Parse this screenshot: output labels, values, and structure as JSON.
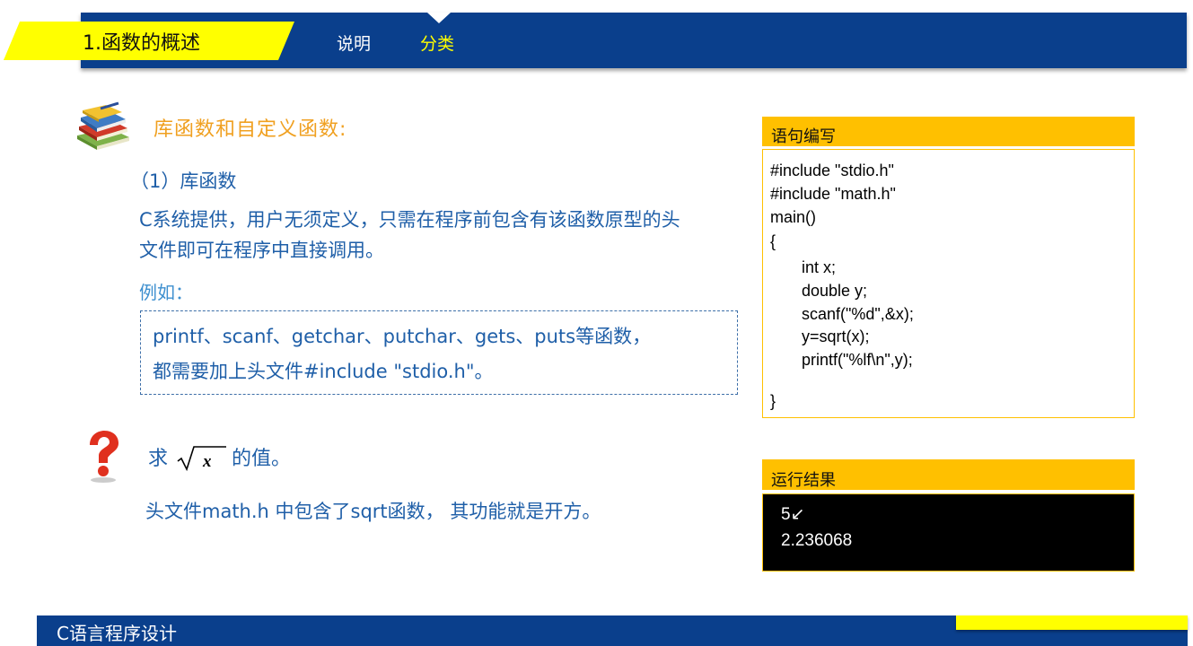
{
  "header": {
    "title": "1.函数的概述",
    "nav": [
      "说明",
      "分类"
    ]
  },
  "main": {
    "heading": "库函数和自定义函数:",
    "subheading": "（1）库函数",
    "description": "C系统提供，用户无须定义，只需在程序前包含有该函数原型的头文件即可在程序中直接调用。",
    "example_label": "例如：",
    "example_line1": "printf、scanf、getchar、putchar、gets、puts等函数，",
    "example_line2": "都需要加上头文件#include \"stdio.h\"。",
    "question_prefix": "求",
    "question_suffix": "的值。",
    "question_formula": "√x",
    "note": "头文件math.h 中包含了sqrt函数， 其功能就是开方。"
  },
  "code_panel": {
    "title": "语句编写",
    "lines": [
      "#include \"stdio.h\"",
      "#include \"math.h\"",
      "main()",
      "{",
      "int x;",
      "double y;",
      "scanf(\"%d\",&x);",
      "y=sqrt(x);",
      "printf(\"%lf\\n\",y);",
      "}"
    ]
  },
  "run_panel": {
    "title": "运行结果",
    "lines": [
      "5↙",
      "2.236068"
    ]
  },
  "footer": {
    "text": "C语言程序设计"
  },
  "colors": {
    "navy": "#0a3f8c",
    "yellow": "#ffff00",
    "gold": "#ffc000",
    "text_blue": "#1f5fa8",
    "orange": "#f0a020"
  }
}
